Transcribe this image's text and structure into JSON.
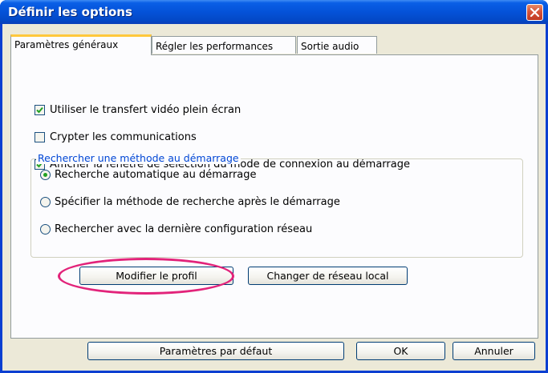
{
  "window": {
    "title": "Définir les options"
  },
  "tabs": [
    {
      "label": "Paramètres généraux"
    },
    {
      "label": "Régler les performances"
    },
    {
      "label": "Sortie audio"
    }
  ],
  "checkboxes": [
    {
      "label": "Utiliser le transfert vidéo plein écran",
      "checked": true
    },
    {
      "label": "Crypter les communications",
      "checked": false
    },
    {
      "label": "Afficher la fenêtre de sélection du mode de connexion au démarrage",
      "checked": true
    }
  ],
  "search_group": {
    "legend": "Rechercher une méthode au démarrage",
    "options": [
      {
        "label": "Recherche automatique au démarrage",
        "selected": true
      },
      {
        "label": "Spécifier la méthode de recherche après le démarrage",
        "selected": false
      },
      {
        "label": "Rechercher avec la dernière configuration réseau",
        "selected": false
      }
    ]
  },
  "profile_buttons": {
    "modify_profile": "Modifier le profil",
    "change_lan": "Changer de réseau local"
  },
  "footer": {
    "defaults": "Paramètres par défaut",
    "ok": "OK",
    "cancel": "Annuler"
  },
  "colors": {
    "titlebar": "#0452d8",
    "highlight": "#e2237a",
    "check": "#21a121",
    "legend": "#0046d5"
  }
}
